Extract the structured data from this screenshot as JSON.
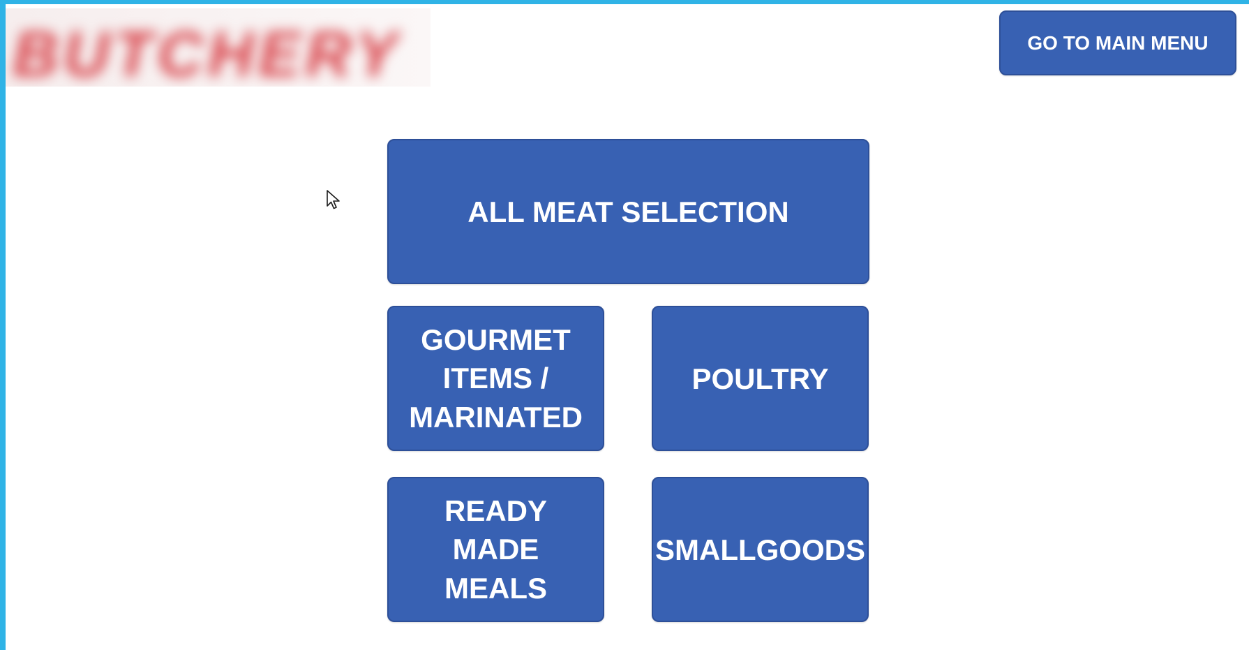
{
  "logo": {
    "text": "BUTCHERY"
  },
  "header": {
    "main_menu_label": "GO TO MAIN MENU"
  },
  "menu": {
    "all_meat": "ALL MEAT SELECTION",
    "gourmet": "GOURMET ITEMS / MARINATED",
    "poultry": "POULTRY",
    "ready_meals": "READY MADE MEALS",
    "smallgoods": "SMALLGOODS"
  },
  "colors": {
    "button": "#3861b3",
    "button_border": "#2d4f98",
    "frame": "#2fb3e6",
    "logo_text": "#d8434a"
  },
  "icons": {
    "cursor": "mouse-pointer-icon"
  }
}
